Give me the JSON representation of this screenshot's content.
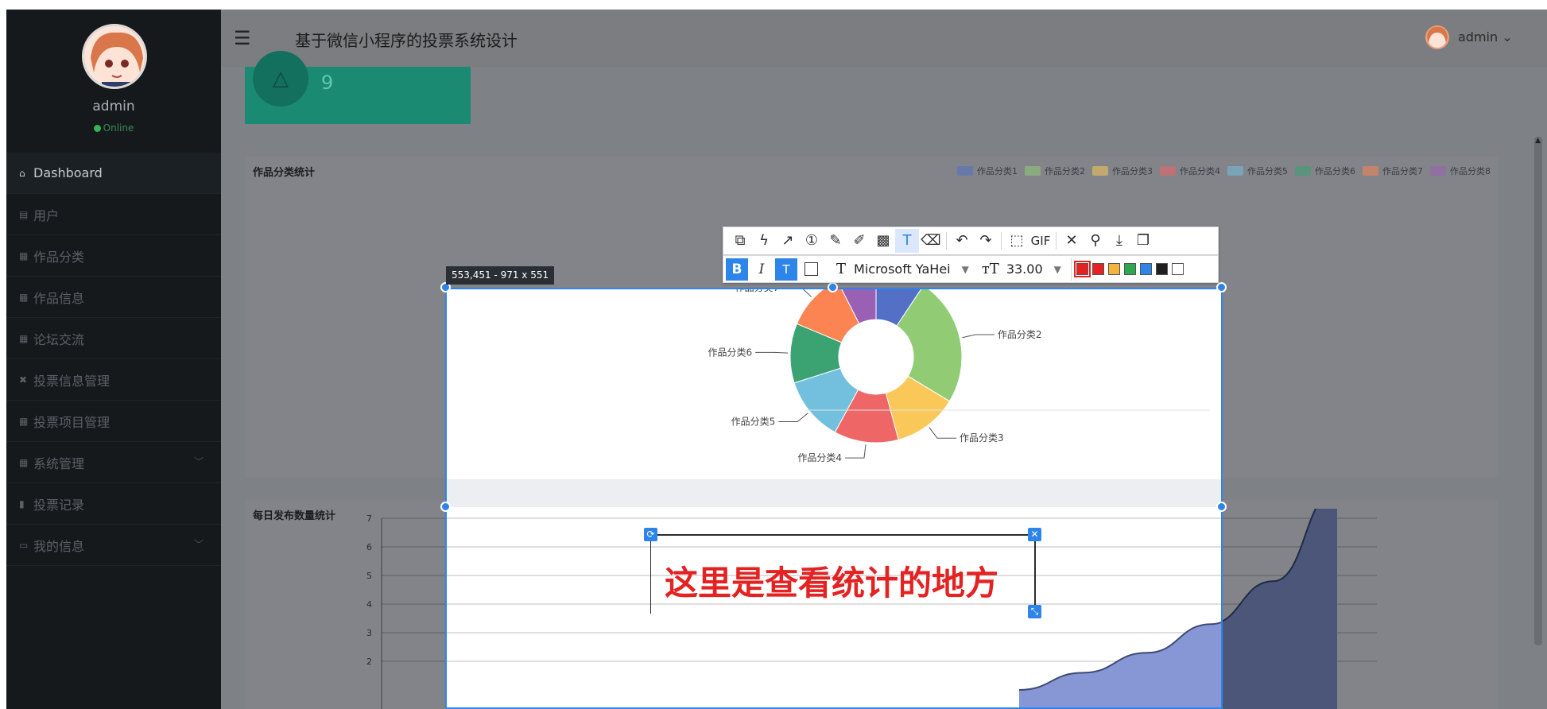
{
  "sidebar": {
    "user_name": "admin",
    "user_status": "Online",
    "items": [
      {
        "label": "Dashboard",
        "icon": "home-icon"
      },
      {
        "label": "用户",
        "icon": "list-icon"
      },
      {
        "label": "作品分类",
        "icon": "grid-icon"
      },
      {
        "label": "作品信息",
        "icon": "grid-icon"
      },
      {
        "label": "论坛交流",
        "icon": "grid-icon"
      },
      {
        "label": "投票信息管理",
        "icon": "ticket-icon"
      },
      {
        "label": "投票项目管理",
        "icon": "grid-icon"
      },
      {
        "label": "系统管理",
        "icon": "grid-icon"
      },
      {
        "label": "投票记录",
        "icon": "bar-chart-icon"
      },
      {
        "label": "我的信息",
        "icon": "window-icon"
      }
    ]
  },
  "header": {
    "title": "基于微信小程序的投票系统设计",
    "user": "admin"
  },
  "stat_card": {
    "value": "9"
  },
  "panels": {
    "category_title": "作品分类统计",
    "daily_title": "每日发布数量统计"
  },
  "capture": {
    "size_label": "553,451 - 971 x 551",
    "font_name": "Microsoft YaHei",
    "font_size": "33.00",
    "gif_label": "GIF",
    "annotation_text": "这里是查看统计的地方",
    "swatch_colors": [
      "#e42222",
      "#e42222",
      "#f2b43a",
      "#2ea84e",
      "#2d85ea",
      "#1f1f1f",
      "#ffffff"
    ]
  },
  "chart_data": [
    {
      "type": "pie",
      "title": "作品分类统计",
      "donut": true,
      "categories": [
        "作品分类1",
        "作品分类2",
        "作品分类3",
        "作品分类4",
        "作品分类5",
        "作品分类6",
        "作品分类7",
        "作品分类8"
      ],
      "values": [
        1,
        2.6,
        1.3,
        1.3,
        1.3,
        1.2,
        1.2,
        0.8
      ],
      "colors": [
        "#5470c6",
        "#91cc75",
        "#fac858",
        "#ee6666",
        "#73c0de",
        "#3ba272",
        "#fc8452",
        "#9a60b4"
      ],
      "legend_position": "top-right"
    },
    {
      "type": "area",
      "title": "每日发布数量统计",
      "y_ticks": [
        2,
        3,
        4,
        5,
        6,
        7
      ],
      "ylim": [
        1,
        7
      ],
      "values": [
        0,
        0.6,
        1.3,
        2.3,
        3.8,
        7
      ],
      "color": "#5470c6"
    }
  ]
}
